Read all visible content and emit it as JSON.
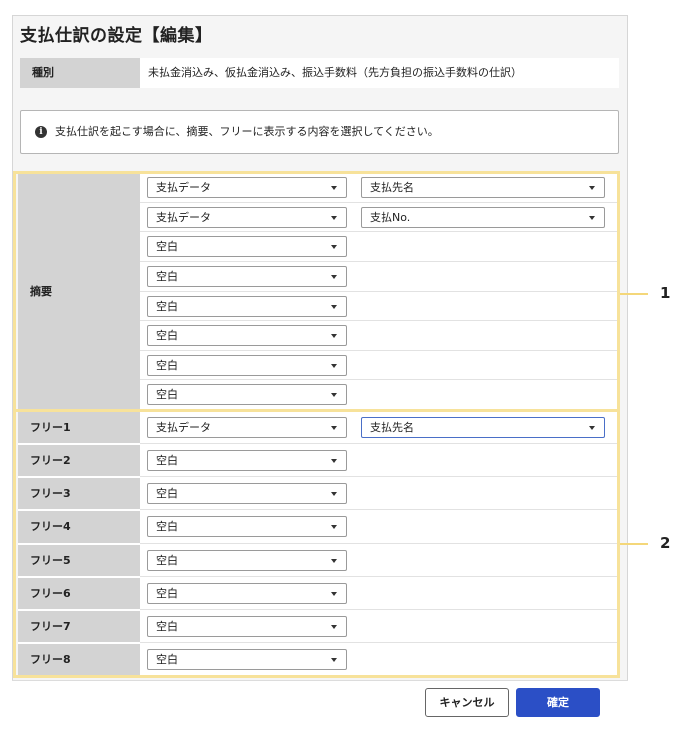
{
  "dialog": {
    "title": "支払仕訳の設定【編集】",
    "type_label": "種別",
    "type_value": "未払金消込み、仮払金消込み、振込手数料（先方負担の振込手数料の仕訳）",
    "info_text": "支払仕訳を起こす場合に、摘要、フリーに表示する内容を選択してください。"
  },
  "summary": {
    "label": "摘要",
    "rows": [
      {
        "primary": "支払データ",
        "secondary": "支払先名"
      },
      {
        "primary": "支払データ",
        "secondary": "支払No."
      },
      {
        "primary": "空白"
      },
      {
        "primary": "空白"
      },
      {
        "primary": "空白"
      },
      {
        "primary": "空白"
      },
      {
        "primary": "空白"
      },
      {
        "primary": "空白"
      }
    ]
  },
  "free": {
    "rows": [
      {
        "label": "フリー1",
        "primary": "支払データ",
        "secondary": "支払先名"
      },
      {
        "label": "フリー2",
        "primary": "空白"
      },
      {
        "label": "フリー3",
        "primary": "空白"
      },
      {
        "label": "フリー4",
        "primary": "空白"
      },
      {
        "label": "フリー5",
        "primary": "空白"
      },
      {
        "label": "フリー6",
        "primary": "空白"
      },
      {
        "label": "フリー7",
        "primary": "空白"
      },
      {
        "label": "フリー8",
        "primary": "空白"
      }
    ]
  },
  "callouts": {
    "one": "1",
    "two": "2"
  },
  "buttons": {
    "cancel": "キャンセル",
    "ok": "確定"
  },
  "colors": {
    "highlight": "#f7e29a",
    "primary": "#2b4fc6",
    "label_bg": "#d3d3d3"
  },
  "icons": {
    "info": "info-circle-icon",
    "dropdown": "chevron-down-icon"
  }
}
